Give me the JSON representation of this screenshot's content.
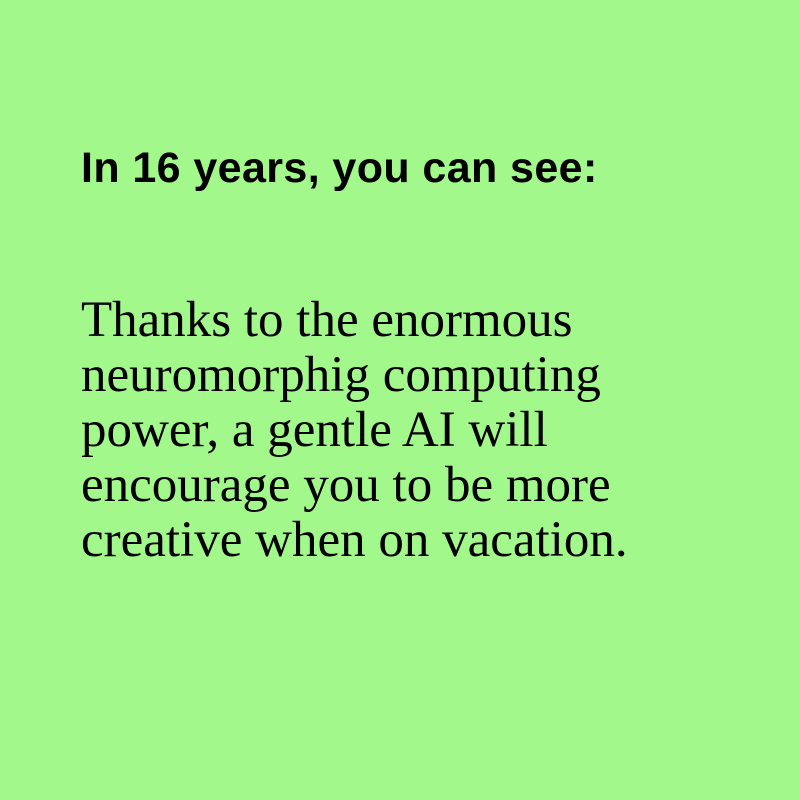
{
  "card": {
    "background_color": "#a2f88a",
    "text_color": "#000000",
    "heading": "In 16 years, you can see:",
    "body": "Thanks to the enormous neuromorphig computing power, a gentle AI will encourage you to be more creative when on vacation."
  }
}
